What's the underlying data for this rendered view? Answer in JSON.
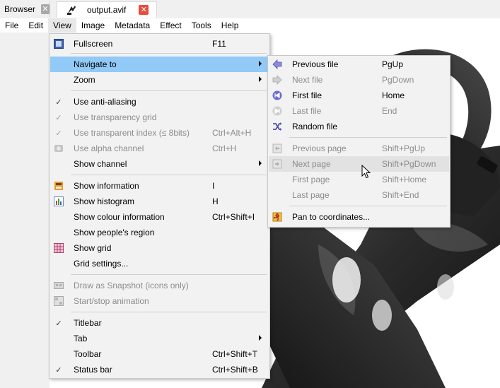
{
  "tabs": [
    {
      "label": "Browser",
      "close": "✕"
    },
    {
      "label": "output.avif",
      "close": "✕"
    }
  ],
  "menubar": [
    "File",
    "Edit",
    "View",
    "Image",
    "Metadata",
    "Effect",
    "Tools",
    "Help"
  ],
  "view_menu": {
    "fullscreen": {
      "label": "Fullscreen",
      "shortcut": "F11"
    },
    "navigate_to": {
      "label": "Navigate to"
    },
    "zoom": {
      "label": "Zoom"
    },
    "anti_aliasing": {
      "label": "Use anti-aliasing"
    },
    "transparency_grid": {
      "label": "Use transparency grid"
    },
    "transparent_index": {
      "label": "Use transparent index (≤ 8bits)",
      "shortcut": "Ctrl+Alt+H"
    },
    "alpha_channel": {
      "label": "Use alpha channel",
      "shortcut": "Ctrl+H"
    },
    "show_channel": {
      "label": "Show channel"
    },
    "show_information": {
      "label": "Show information",
      "shortcut": "I"
    },
    "show_histogram": {
      "label": "Show histogram",
      "shortcut": "H"
    },
    "show_colour_information": {
      "label": "Show colour information",
      "shortcut": "Ctrl+Shift+I"
    },
    "show_peoples_region": {
      "label": "Show people's region"
    },
    "show_grid": {
      "label": "Show grid"
    },
    "grid_settings": {
      "label": "Grid settings..."
    },
    "draw_as_snapshot": {
      "label": "Draw as Snapshot (icons only)"
    },
    "start_stop_animation": {
      "label": "Start/stop animation"
    },
    "titlebar": {
      "label": "Titlebar"
    },
    "tab": {
      "label": "Tab"
    },
    "toolbar": {
      "label": "Toolbar",
      "shortcut": "Ctrl+Shift+T"
    },
    "status_bar": {
      "label": "Status bar",
      "shortcut": "Ctrl+Shift+B"
    },
    "check_glyph": "✓"
  },
  "navigate_menu": {
    "previous_file": {
      "label": "Previous file",
      "shortcut": "PgUp"
    },
    "next_file": {
      "label": "Next file",
      "shortcut": "PgDown"
    },
    "first_file": {
      "label": "First file",
      "shortcut": "Home"
    },
    "last_file": {
      "label": "Last file",
      "shortcut": "End"
    },
    "random_file": {
      "label": "Random file"
    },
    "previous_page": {
      "label": "Previous page",
      "shortcut": "Shift+PgUp"
    },
    "next_page": {
      "label": "Next page",
      "shortcut": "Shift+PgDown"
    },
    "first_page": {
      "label": "First page",
      "shortcut": "Shift+Home"
    },
    "last_page": {
      "label": "Last page",
      "shortcut": "Shift+End"
    },
    "pan_to_coordinates": {
      "label": "Pan to coordinates..."
    }
  },
  "colors": {
    "selection": "#91c9f7",
    "close_active": "#e74c3c",
    "nav_icon": "#6a6ad8"
  }
}
